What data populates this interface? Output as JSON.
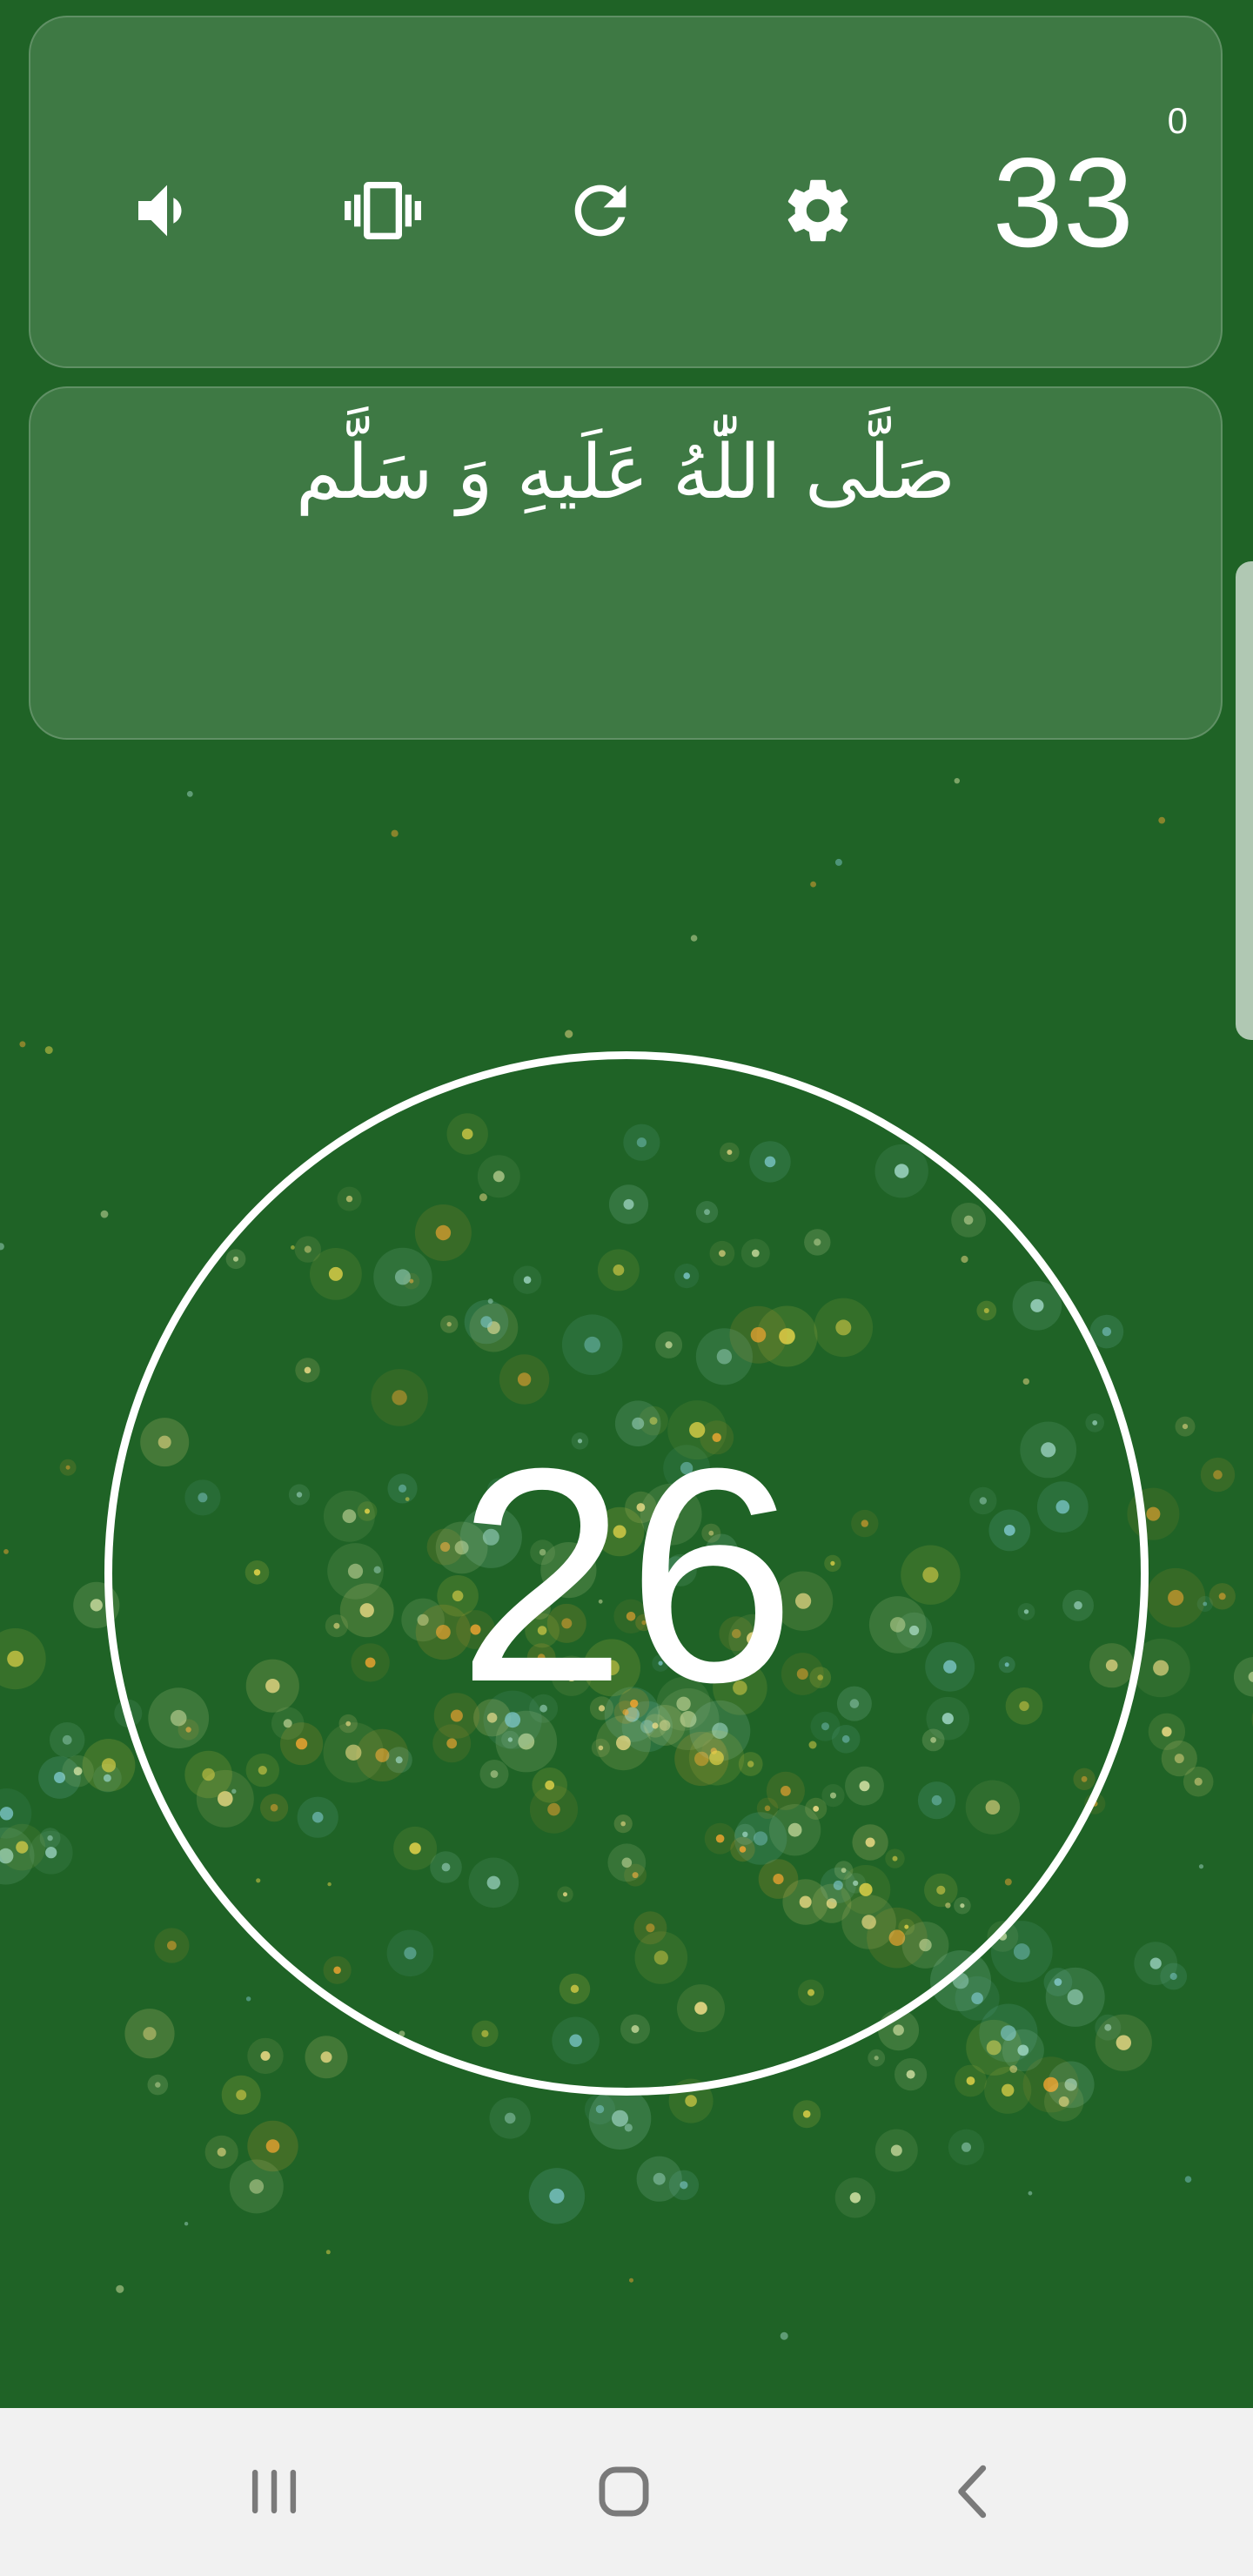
{
  "app": {
    "accent": "#1f6326",
    "card_tint": "#ffffff"
  },
  "toolbar": {
    "sound_icon": "volume-up-icon",
    "vibrate_icon": "vibration-icon",
    "reset_icon": "refresh-icon",
    "settings_icon": "gear-icon",
    "target_count": "33",
    "cycle_count": "0"
  },
  "prayer": {
    "text": "صَلَّى اللّٰهُ عَلَيهِ وَ سَلَّم"
  },
  "counter": {
    "value": "26"
  },
  "navbar": {
    "recents_icon": "recent-apps-icon",
    "home_icon": "home-icon",
    "back_icon": "back-icon"
  }
}
